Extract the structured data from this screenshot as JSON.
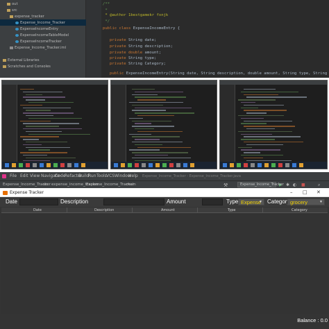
{
  "ide_top": {
    "tree": [
      {
        "label": "out",
        "icon": "folder"
      },
      {
        "label": "src",
        "icon": "folder"
      },
      {
        "label": "expense_tracker",
        "icon": "folder"
      },
      {
        "label": "Expense_Income_Tracker",
        "icon": "class"
      },
      {
        "label": "ExpenseIncomeEntry",
        "icon": "class"
      },
      {
        "label": "ExpenseIncomeTableModel",
        "icon": "class"
      },
      {
        "label": "ExpenseIncomeTracker",
        "icon": "class"
      },
      {
        "label": "Expense_Income_Tracker.iml",
        "icon": "file"
      },
      {
        "label": "External Libraries",
        "icon": "folder"
      },
      {
        "label": "Scratches and Consoles",
        "icon": "folder"
      }
    ],
    "code": [
      {
        "kind": "comment",
        "text": "/**"
      },
      {
        "kind": "comment",
        "text": " *"
      },
      {
        "kind": "annotation",
        "text": " * @author 1bestgamekr fxnjk"
      },
      {
        "kind": "comment",
        "text": " */"
      },
      {
        "kind": "classdecl",
        "kw": "public class",
        "rest": " ExpenseIncomeEntry {"
      },
      {
        "kind": "blank",
        "text": ""
      },
      {
        "kind": "field",
        "kw": "private",
        "rest": " String date;"
      },
      {
        "kind": "field",
        "kw": "private",
        "rest": " String description;"
      },
      {
        "kind": "field",
        "kw": "private double",
        "rest": " amount;"
      },
      {
        "kind": "field",
        "kw": "private",
        "rest": " String type;"
      },
      {
        "kind": "field",
        "kw": "private",
        "rest": " String Category;"
      },
      {
        "kind": "blank",
        "text": ""
      },
      {
        "kind": "ctor",
        "kw": "public",
        "rest": " ExpenseIncomeEntry(String date, String description, double amount, String type, String Category)"
      }
    ]
  },
  "ide_menu": [
    "File",
    "Edit",
    "View",
    "Navigate",
    "Code",
    "Refactor",
    "Build",
    "Run",
    "Tools",
    "VCS",
    "Window",
    "Help"
  ],
  "ide_window_title": "Expense_Income_Tracker - Expense_Income_Tracker.java",
  "ide_breadcrumbs": [
    "Expense_Income_Tracker",
    "src",
    "expense_income_tracker",
    "Expense_Income_Tracker",
    "main"
  ],
  "run_config": "Expense_Income_Tracker",
  "app": {
    "title": "Expense Tracker",
    "form": {
      "date_label": "Date",
      "description_label": "Description",
      "amount_label": "Amount",
      "type_label": "Type",
      "type_value": "Expense",
      "category_label": "Category",
      "category_value": "grocery"
    },
    "columns": [
      "Date",
      "Description",
      "Amount",
      "Type",
      "Category"
    ],
    "balance_text": "Balance : 0.0"
  },
  "colors": {
    "ide_bg": "#2b2b2b",
    "app_bg": "#343434",
    "select_text": "#f0d000"
  }
}
